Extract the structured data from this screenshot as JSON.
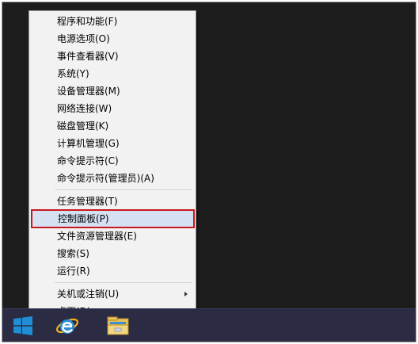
{
  "context_menu": {
    "groups": [
      {
        "items": [
          {
            "label": "程序和功能(F)"
          },
          {
            "label": "电源选项(O)"
          },
          {
            "label": "事件查看器(V)"
          },
          {
            "label": "系统(Y)"
          },
          {
            "label": "设备管理器(M)"
          },
          {
            "label": "网络连接(W)"
          },
          {
            "label": "磁盘管理(K)"
          },
          {
            "label": "计算机管理(G)"
          },
          {
            "label": "命令提示符(C)"
          },
          {
            "label": "命令提示符(管理员)(A)"
          }
        ]
      },
      {
        "items": [
          {
            "label": "任务管理器(T)"
          },
          {
            "label": "控制面板(P)",
            "selected": true
          },
          {
            "label": "文件资源管理器(E)"
          },
          {
            "label": "搜索(S)"
          },
          {
            "label": "运行(R)"
          }
        ]
      },
      {
        "items": [
          {
            "label": "关机或注销(U)",
            "has_submenu": true
          },
          {
            "label": "桌面(D)"
          }
        ]
      }
    ]
  },
  "annotation": {
    "highlight_color": "#c8171f"
  },
  "taskbar": {
    "background_color": "#2b2b44",
    "start_icon": "windows-logo-icon",
    "apps": [
      {
        "icon": "internet-explorer-icon"
      },
      {
        "icon": "file-explorer-icon"
      }
    ]
  },
  "colors": {
    "desktop": "#1d1d1d",
    "menu_background": "#f2f2f2",
    "selected_item": "#d5e1f2",
    "windows_logo": "#1e8fd6"
  }
}
